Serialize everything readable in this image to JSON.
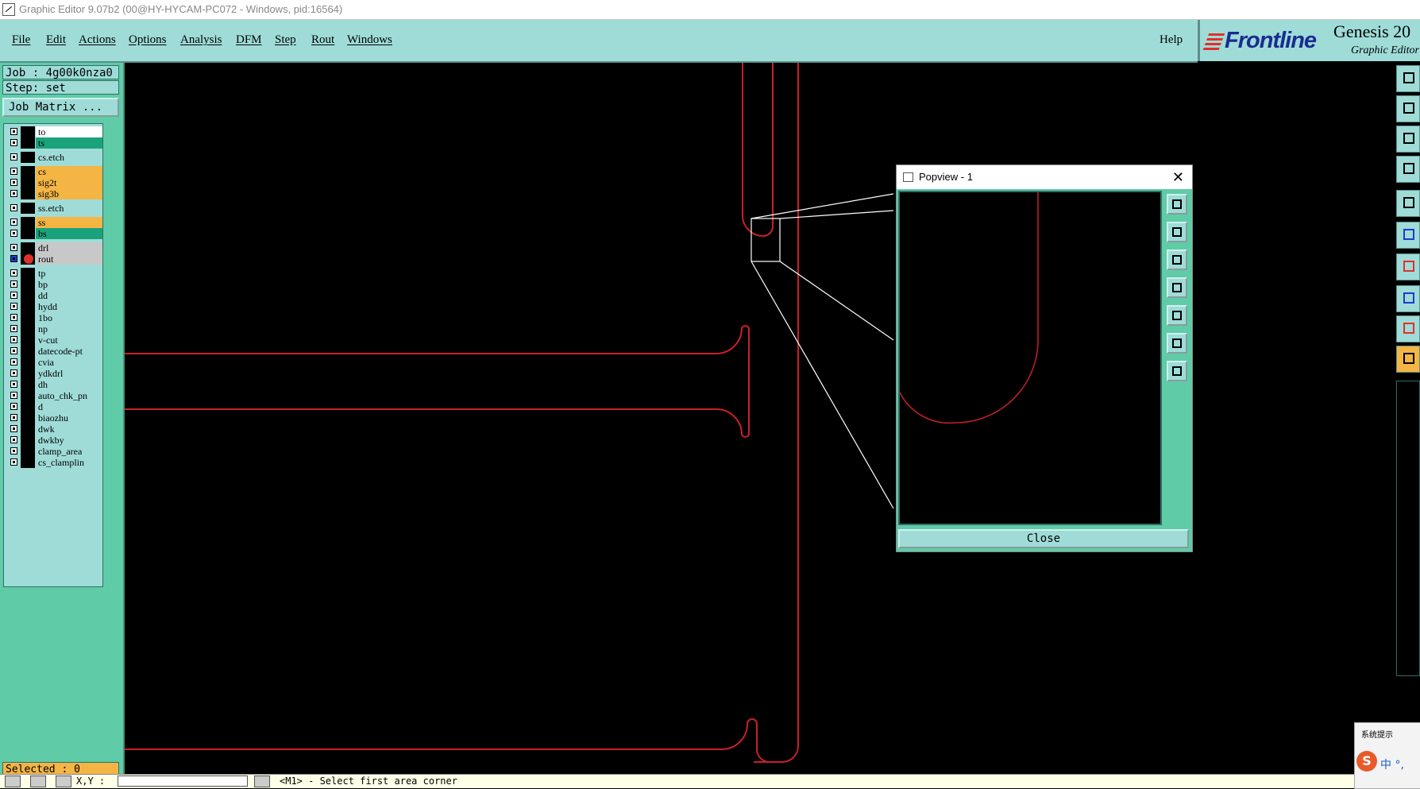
{
  "window": {
    "title": "Graphic Editor 9.07b2 (00@HY-HYCAM-PC072 - Windows, pid:16564)"
  },
  "menu": {
    "items": [
      "File",
      "Edit",
      "Actions",
      "Options",
      "Analysis",
      "DFM",
      "Step",
      "Rout",
      "Windows"
    ],
    "help": "Help"
  },
  "brand": {
    "logo": "Frontline",
    "product": "Genesis 20",
    "subtitle": "Graphic Editor"
  },
  "job": {
    "job_line": "Job : 4g00k0nza0",
    "step_line": "Step: set",
    "matrix_button": "Job Matrix ..."
  },
  "layers": [
    {
      "name": "to",
      "color": "#ffffff"
    },
    {
      "name": "ts",
      "color": "#1aa37a"
    },
    {
      "name": "cs.etch",
      "color": "#9fdcd8"
    },
    {
      "name": "cs",
      "color": "#f4b545"
    },
    {
      "name": "sig2t",
      "color": "#f4b545"
    },
    {
      "name": "sig3b",
      "color": "#f4b545"
    },
    {
      "name": "ss.etch",
      "color": "#9fdcd8"
    },
    {
      "name": "ss",
      "color": "#f4b545"
    },
    {
      "name": "bs",
      "color": "#1aa37a"
    },
    {
      "name": "drl",
      "color": "#c8c8c8"
    },
    {
      "name": "rout",
      "color": "#c8c8c8",
      "active": true
    },
    {
      "name": "tp",
      "color": "#9fdcd8"
    },
    {
      "name": "bp",
      "color": "#9fdcd8"
    },
    {
      "name": "dd",
      "color": "#9fdcd8"
    },
    {
      "name": "hydd",
      "color": "#9fdcd8"
    },
    {
      "name": "1bo",
      "color": "#9fdcd8"
    },
    {
      "name": "np",
      "color": "#9fdcd8"
    },
    {
      "name": "v-cut",
      "color": "#9fdcd8"
    },
    {
      "name": "datecode-pt",
      "color": "#9fdcd8"
    },
    {
      "name": "cvia",
      "color": "#9fdcd8"
    },
    {
      "name": "ydkdrl",
      "color": "#9fdcd8"
    },
    {
      "name": "dh",
      "color": "#9fdcd8"
    },
    {
      "name": "auto_chk_pn",
      "color": "#9fdcd8"
    },
    {
      "name": "d",
      "color": "#9fdcd8"
    },
    {
      "name": "biaozhu",
      "color": "#9fdcd8"
    },
    {
      "name": "dwk",
      "color": "#9fdcd8"
    },
    {
      "name": "dwkby",
      "color": "#9fdcd8"
    },
    {
      "name": "clamp_area",
      "color": "#9fdcd8"
    },
    {
      "name": "cs_clamplin",
      "color": "#9fdcd8"
    }
  ],
  "selected": "Selected : 0",
  "popview": {
    "title": "Popview - 1",
    "close_x": "✕",
    "close_button": "Close"
  },
  "statusbar": {
    "coords_label": "X,Y :",
    "coords_value": "",
    "prompt": "<M1> - Select first area corner"
  },
  "notification": {
    "title": "系统提示",
    "ime": "中 °,"
  },
  "colors": {
    "panel": "#9fdcd8",
    "panel_dark": "#5fcca7",
    "highlight": "#f4b545",
    "rout_line": "#c8202a",
    "zoom_line": "#ffffff"
  }
}
